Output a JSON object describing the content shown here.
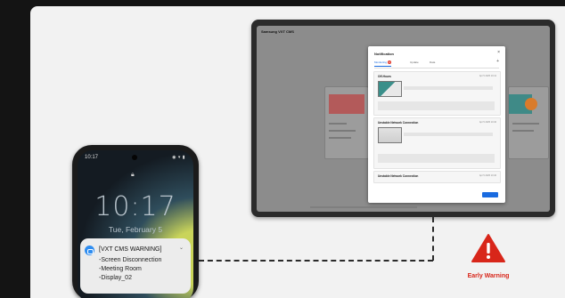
{
  "monitor": {
    "app_title": "Samsung VXT CMS",
    "dialog": {
      "title": "Notification",
      "tabs": [
        {
          "label": "Monitoring",
          "badge": "3",
          "active": true
        },
        {
          "label": "Update"
        },
        {
          "label": "Data"
        }
      ],
      "cards": [
        {
          "title": "Off-Hours",
          "time": "Apr 5 2025 10:41"
        },
        {
          "title": "Unstable Network Connection",
          "time": "Apr 5 2025 10:40"
        },
        {
          "title": "Unstable Network Connection",
          "time": "Apr 5 2025 10:40"
        }
      ],
      "apply_label": ""
    }
  },
  "phone": {
    "status_time": "10:17",
    "status_icons": "◉ ▾ ▮",
    "lock_time": "10:17",
    "lock_date": "Tue, February 5",
    "notification": {
      "title": "[VXT CMS WARNING]",
      "lines": [
        "-Screen Disconnection",
        "-Meeting Room",
        "-Display_02"
      ]
    }
  },
  "warning": {
    "label": "Early Warning",
    "color": "#d8261a"
  },
  "colors": {
    "accent_blue": "#1a6be0",
    "alert_red": "#d8261a"
  }
}
